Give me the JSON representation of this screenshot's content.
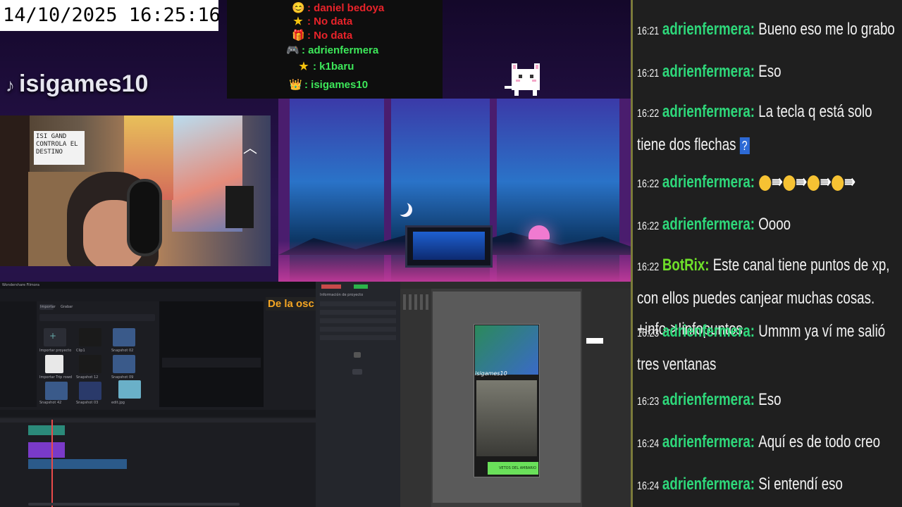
{
  "overlay": {
    "datetime": "14/10/2025 16:25:16",
    "brand": "isigames10",
    "brand_icon": "tiktok-icon",
    "info_rows": [
      {
        "icon": "😊",
        "icon_name": "smile-face-icon",
        "label": ": daniel bedoya",
        "color": "#e8232a"
      },
      {
        "icon": "★",
        "icon_name": "star-icon",
        "label": ": No data",
        "color": "#e8232a"
      },
      {
        "icon": "🎁",
        "icon_name": "gift-icon",
        "label": ": No data",
        "color": "#e8232a"
      },
      {
        "icon": "🎮",
        "icon_name": "gamepad-icon",
        "label": ": adrienfermera",
        "color": "#3de85a"
      },
      {
        "icon": "★",
        "icon_name": "star-icon",
        "label": ": k1baru",
        "color": "#3de85a"
      },
      {
        "icon": "👑",
        "icon_name": "crown-icon",
        "label": ": isigames10",
        "color": "#3de85a"
      }
    ]
  },
  "webcam": {
    "sign_text": "ISI GAND CONTROLA EL DESTINO"
  },
  "editor": {
    "title_banner": "De la osc",
    "left_tabs": [
      "Importar",
      "Grabar"
    ],
    "media_items": [
      "Importar proyecto",
      "Clip1",
      "Snapshot 02",
      "Importar Trip rowd",
      "Snapshot 12",
      "Snapshot 09",
      "Snapshot 42",
      "Snapshot 03",
      "edit.jpg"
    ],
    "props_title": "Información de proyecto",
    "watermark_text": "isigames10",
    "preview_footer": "VETOS DEL AMBARIO"
  },
  "chat": {
    "messages": [
      {
        "time": "16:21",
        "user": "adrienfermera",
        "text": "Bueno eso me lo grabo",
        "bot": false
      },
      {
        "time": "16:21",
        "user": "adrienfermera",
        "text": "Eso",
        "bot": false
      },
      {
        "time": "16:22",
        "user": "adrienfermera",
        "text": "La tecla q está solo tiene dos flechas",
        "bot": false,
        "emote_box": "?"
      },
      {
        "time": "16:22",
        "user": "adrienfermera",
        "text": "",
        "bot": false,
        "emote_chain": true
      },
      {
        "time": "16:22",
        "user": "adrienfermera",
        "text": "Oooo",
        "bot": false
      },
      {
        "time": "16:22",
        "user": "BotRix",
        "text": "Este canal tiene puntos de xp, con ellos puedes canjear muchas cosas. +info->!infopuntos",
        "bot": true
      },
      {
        "time": "16:23",
        "user": "adrienfermera",
        "text": "Ummm ya ví me salió tres ventanas",
        "bot": false
      },
      {
        "time": "16:23",
        "user": "adrienfermera",
        "text": "Eso",
        "bot": false
      },
      {
        "time": "16:24",
        "user": "adrienfermera",
        "text": "Aquí es de todo creo",
        "bot": false
      },
      {
        "time": "16:24",
        "user": "adrienfermera",
        "text": "Si entendí eso",
        "bot": false
      }
    ]
  }
}
